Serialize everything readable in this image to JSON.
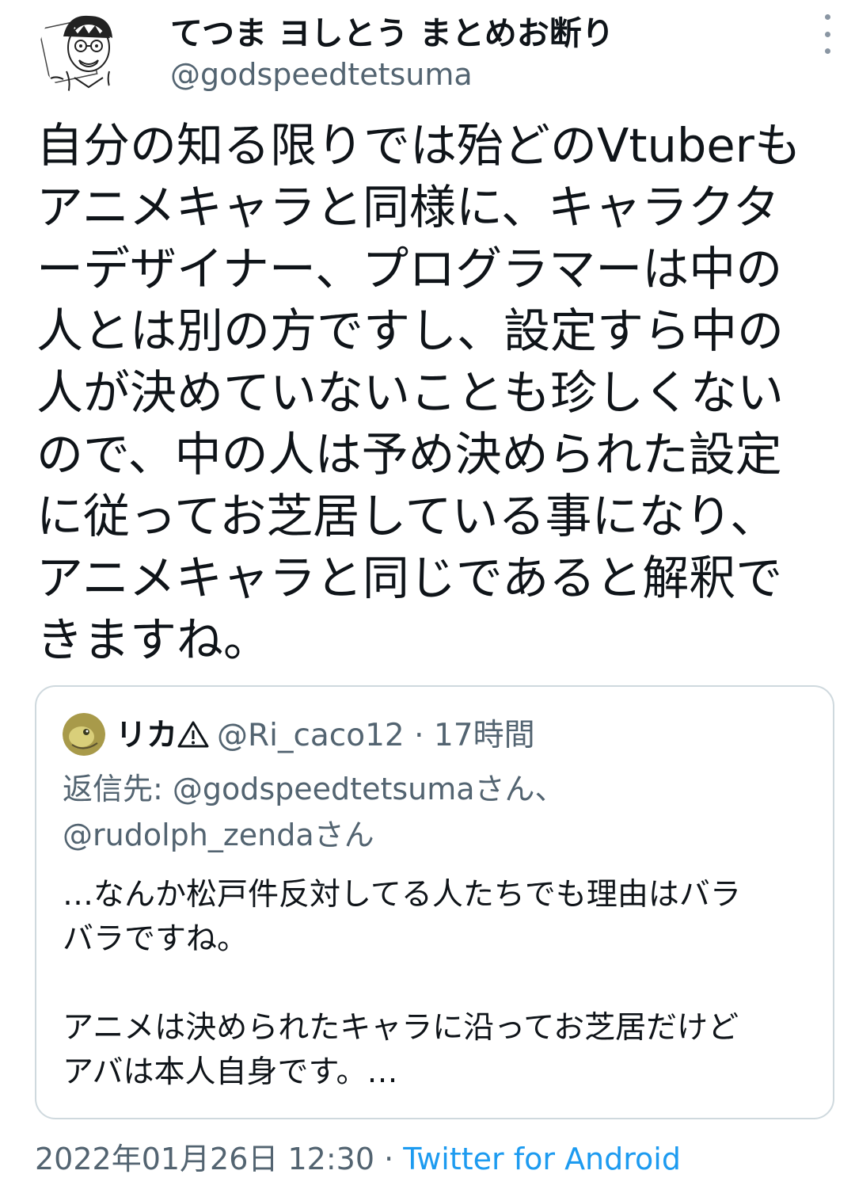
{
  "author": {
    "display_name": "てつま ヨしとう まとめお断り",
    "handle": "@godspeedtetsuma",
    "avatar_icon": "manga-portrait-avatar"
  },
  "tweet": {
    "lines": [
      "自分の知る限りでは殆どのVtuberも",
      "アニメキャラと同様に、キャラクタ",
      "ーデザイナー、プログラマーは中の",
      "人とは別の方ですし、設定すら中の",
      "人が決めていないことも珍しくない",
      "ので、中の人は予め決められた設定",
      "に従ってお芝居している事になり、",
      "アニメキャラと同じであると解釈で",
      "きますね。"
    ]
  },
  "quoted": {
    "name": "リカ",
    "handle": "@Ri_caco12",
    "separator": "·",
    "time": "17時間",
    "reply_to_lines": [
      "返信先: @godspeedtetsumaさん、",
      "@rudolph_zendaさん"
    ],
    "body_lines": [
      "…なんか松戸件反対してる人たちでも理由はバラ",
      "バラですね。",
      "",
      "アニメは決められたキャラに沿ってお芝居だけど",
      "アバは本人自身です。…"
    ]
  },
  "footer": {
    "timestamp": "2022年01月26日 12:30",
    "separator": "·",
    "source": "Twitter for Android"
  },
  "colors": {
    "text": "#0f1419",
    "secondary": "#536471",
    "link": "#1d9bf0",
    "border": "#cfd9de"
  }
}
